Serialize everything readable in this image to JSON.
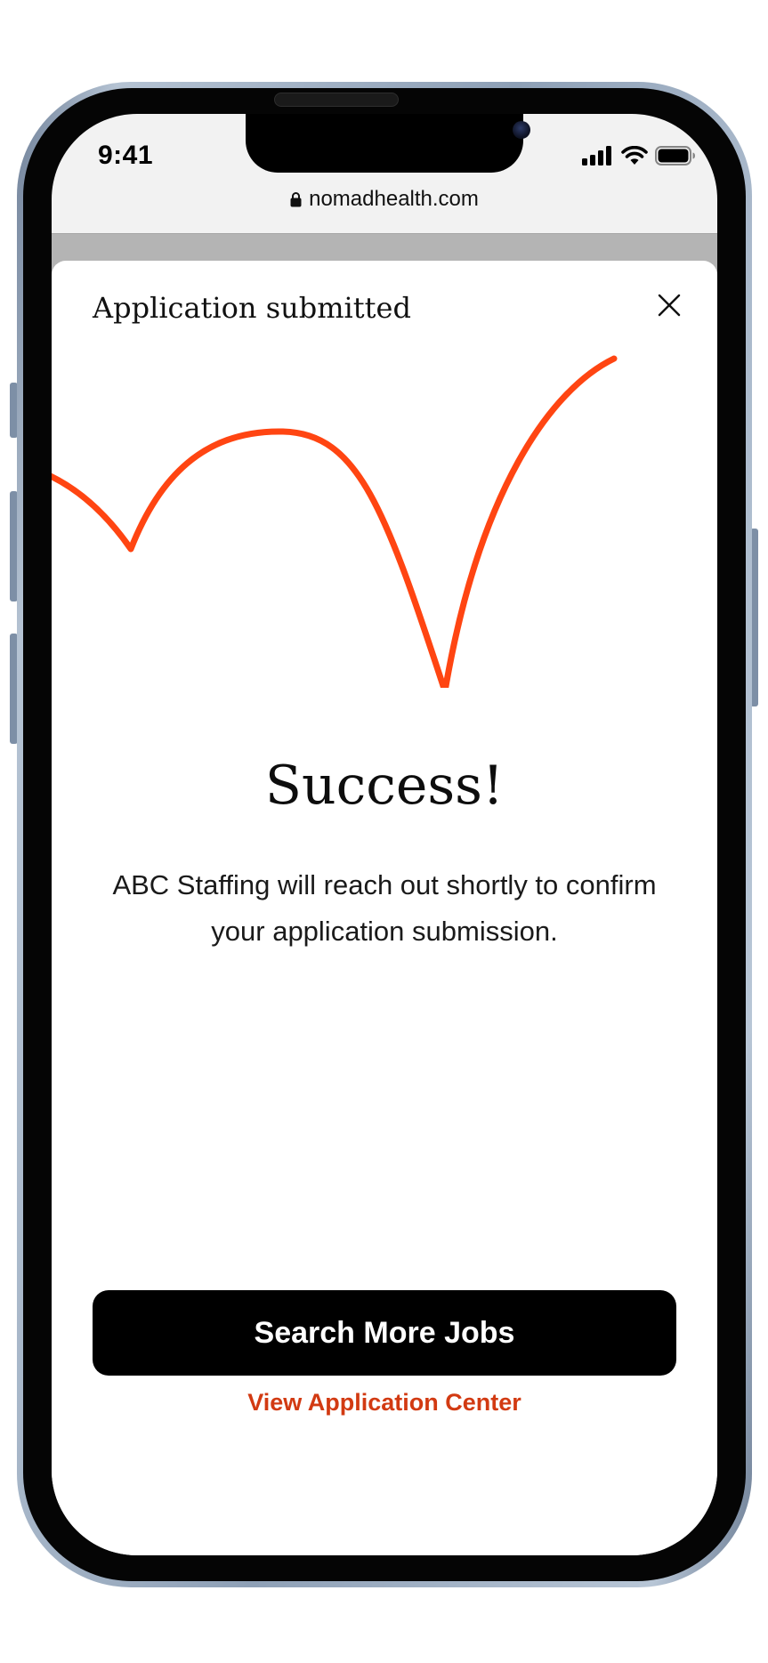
{
  "status_bar": {
    "time": "9:41",
    "icons": [
      "signal-icon",
      "wifi-icon",
      "battery-icon"
    ]
  },
  "browser": {
    "url": "nomadhealth.com",
    "lock_icon": "lock-icon"
  },
  "modal": {
    "title": "Application submitted",
    "close_icon": "close-icon",
    "heading": "Success!",
    "message": "ABC Staffing will reach out shortly to confirm your application submission.",
    "primary_button_label": "Search More Jobs",
    "secondary_link_label": "View Application Center"
  },
  "colors": {
    "accent_line": "#ff4512",
    "link": "#d23a12",
    "button_bg": "#000000",
    "button_text": "#ffffff",
    "device_frame": "#9fb0c4"
  }
}
